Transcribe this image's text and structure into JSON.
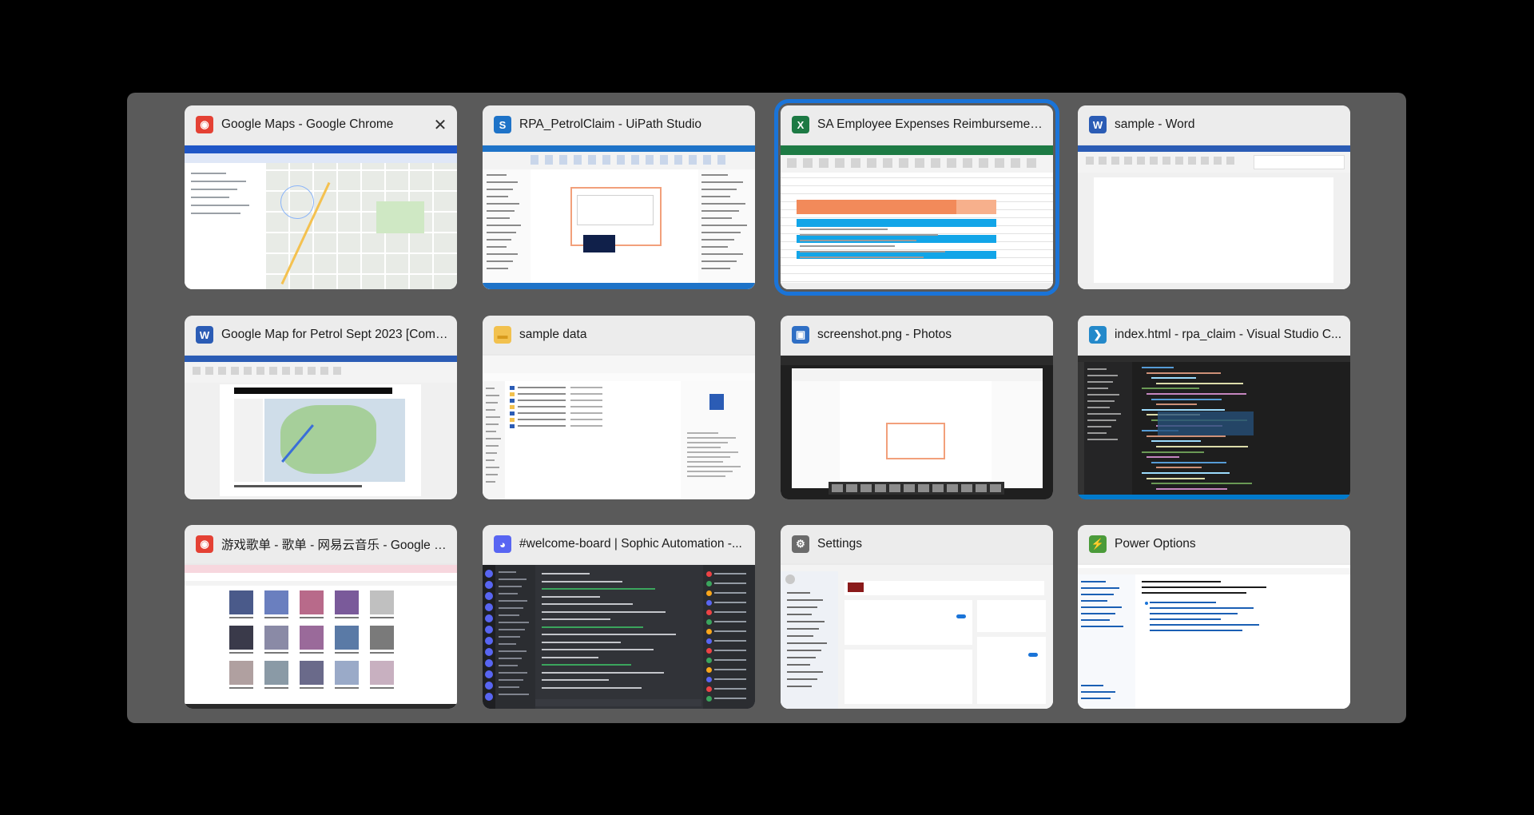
{
  "switcher": {
    "windows": [
      {
        "title": "Google Maps - Google Chrome",
        "icon": "chrome-icon",
        "icon_color": "#e44134",
        "icon_glyph": "◉",
        "preview": "maps",
        "has_close": true,
        "selected": false
      },
      {
        "title": "RPA_PetrolClaim - UiPath Studio",
        "icon": "uipath-icon",
        "icon_color": "#1e73c8",
        "icon_glyph": "S",
        "preview": "uipath",
        "has_close": false,
        "selected": false
      },
      {
        "title": "SA Employee Expenses Reimbursement...",
        "icon": "excel-icon",
        "icon_color": "#1d7a44",
        "icon_glyph": "X",
        "preview": "excel",
        "has_close": false,
        "selected": true
      },
      {
        "title": "sample - Word",
        "icon": "word-icon",
        "icon_color": "#2b5cb5",
        "icon_glyph": "W",
        "preview": "word",
        "has_close": false,
        "selected": false
      },
      {
        "title": "Google Map for Petrol Sept 2023 [Comp...",
        "icon": "word-icon",
        "icon_color": "#2b5cb5",
        "icon_glyph": "W",
        "preview": "wordmap",
        "has_close": false,
        "selected": false
      },
      {
        "title": "sample data",
        "icon": "folder-icon",
        "icon_color": "#f2c14e",
        "icon_glyph": "▬",
        "preview": "explorer",
        "has_close": false,
        "selected": false
      },
      {
        "title": "screenshot.png - Photos",
        "icon": "photos-icon",
        "icon_color": "#2f6fc5",
        "icon_glyph": "▣",
        "preview": "photos",
        "has_close": false,
        "selected": false
      },
      {
        "title": "index.html - rpa_claim - Visual Studio C...",
        "icon": "vscode-icon",
        "icon_color": "#2489ca",
        "icon_glyph": "❯",
        "preview": "vscode",
        "has_close": false,
        "selected": false
      },
      {
        "title": "游戏歌单 - 歌单 - 网易云音乐 - Google C...",
        "icon": "chrome-icon",
        "icon_color": "#e44134",
        "icon_glyph": "◉",
        "preview": "music",
        "has_close": false,
        "selected": false
      },
      {
        "title": "#welcome-board | Sophic Automation -...",
        "icon": "discord-icon",
        "icon_color": "#5865f2",
        "icon_glyph": "◕",
        "preview": "discord",
        "has_close": false,
        "selected": false
      },
      {
        "title": "Settings",
        "icon": "settings-gear-icon",
        "icon_color": "#6b6b6b",
        "icon_glyph": "⚙",
        "preview": "settings",
        "has_close": false,
        "selected": false
      },
      {
        "title": "Power Options",
        "icon": "power-options-icon",
        "icon_color": "#4b9b3a",
        "icon_glyph": "⚡",
        "preview": "power",
        "has_close": false,
        "selected": false
      }
    ]
  }
}
